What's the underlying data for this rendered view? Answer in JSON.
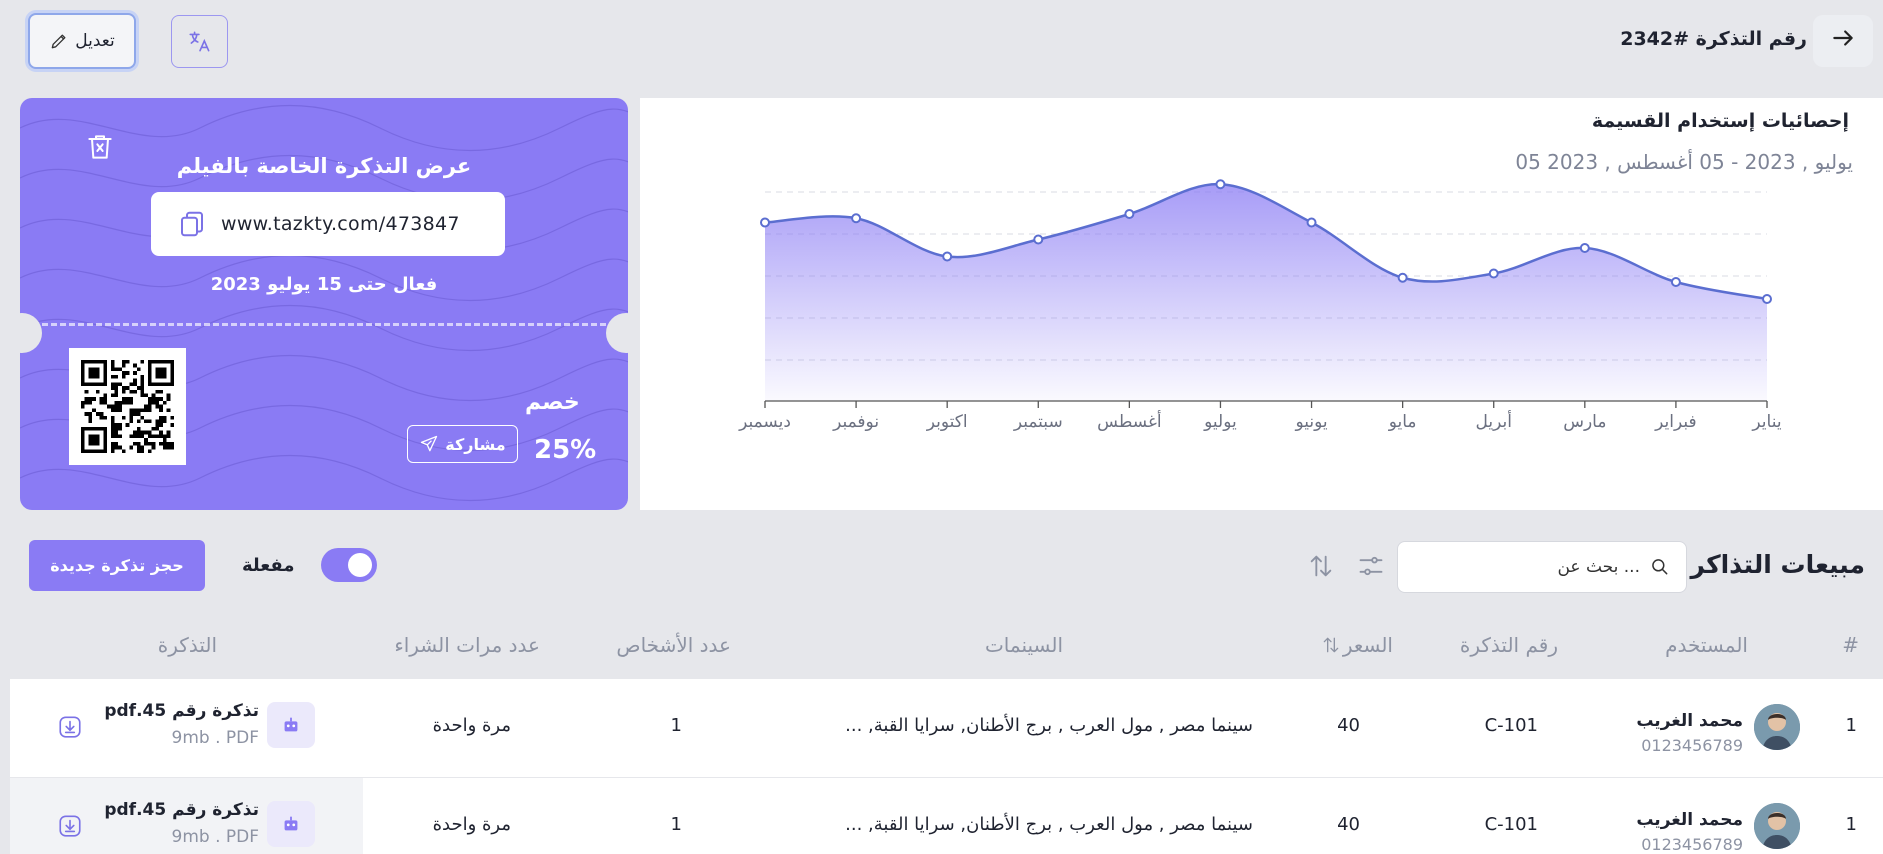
{
  "header": {
    "title": "رقم التذكرة #2342",
    "edit_label": "تعديل",
    "back_icon": "arrow-right-icon",
    "translate_icon": "translate-icon"
  },
  "ticket": {
    "title": "عرض التذكرة الخاصة بالفيلم",
    "url": "www.tazkty.com/473847",
    "valid_until": "فعال حتى 15 يوليو 2023",
    "discount_label": "خصم",
    "discount_value": "25%",
    "share_label": "مشاركة",
    "accent": "#8a7bf4"
  },
  "chart": {
    "title": "إحصائيات إستخدام القسيمة",
    "subtitle": "يوليو , 2023 - 05 أغسطس , 2023 05"
  },
  "chart_data": {
    "type": "area",
    "categories": [
      "يناير",
      "فبراير",
      "مارس",
      "أبريل",
      "مايو",
      "يونيو",
      "يوليو",
      "أغسطس",
      "سبتمبر",
      "اكتوبر",
      "نوفمبر",
      "ديسمبر"
    ],
    "values": [
      24,
      28,
      36,
      30,
      29,
      42,
      51,
      44,
      38,
      34,
      43,
      42
    ],
    "ylim": [
      0,
      56
    ],
    "grid": true,
    "color": "#5b6ed0",
    "fill": "#8a7bf4"
  },
  "sales": {
    "title": "مبيعات التذاكر",
    "search_placeholder": "بحث عن ...",
    "toggle_label": "مفعلة",
    "new_button": "حجز تذكرة جديدة"
  },
  "table": {
    "headers": {
      "num": "#",
      "user": "المستخدم",
      "ticket_no": "رقم التذكرة",
      "price": "السعر",
      "cinemas": "السينمات",
      "persons": "عدد الأشخاص",
      "purchases": "عدد مرات الشراء",
      "ticket": "التذكرة"
    },
    "rows": [
      {
        "num": "1",
        "name": "محمد الغريب",
        "phone": "0123456789",
        "ticket_no": "C-101",
        "price": "40",
        "cinemas": "سينما مصر , مول العرب , برج الأطنان, سرايا القبة, ...",
        "persons": "1",
        "purchases": "مرة واحدة",
        "file_name": "تذكرة رقم 45.pdf",
        "file_meta": "9mb . PDF"
      },
      {
        "num": "1",
        "name": "محمد الغريب",
        "phone": "0123456789",
        "ticket_no": "C-101",
        "price": "40",
        "cinemas": "سينما مصر , مول العرب , برج الأطنان, سرايا القبة, ...",
        "persons": "1",
        "purchases": "مرة واحدة",
        "file_name": "تذكرة رقم 45.pdf",
        "file_meta": "9mb . PDF"
      }
    ]
  }
}
